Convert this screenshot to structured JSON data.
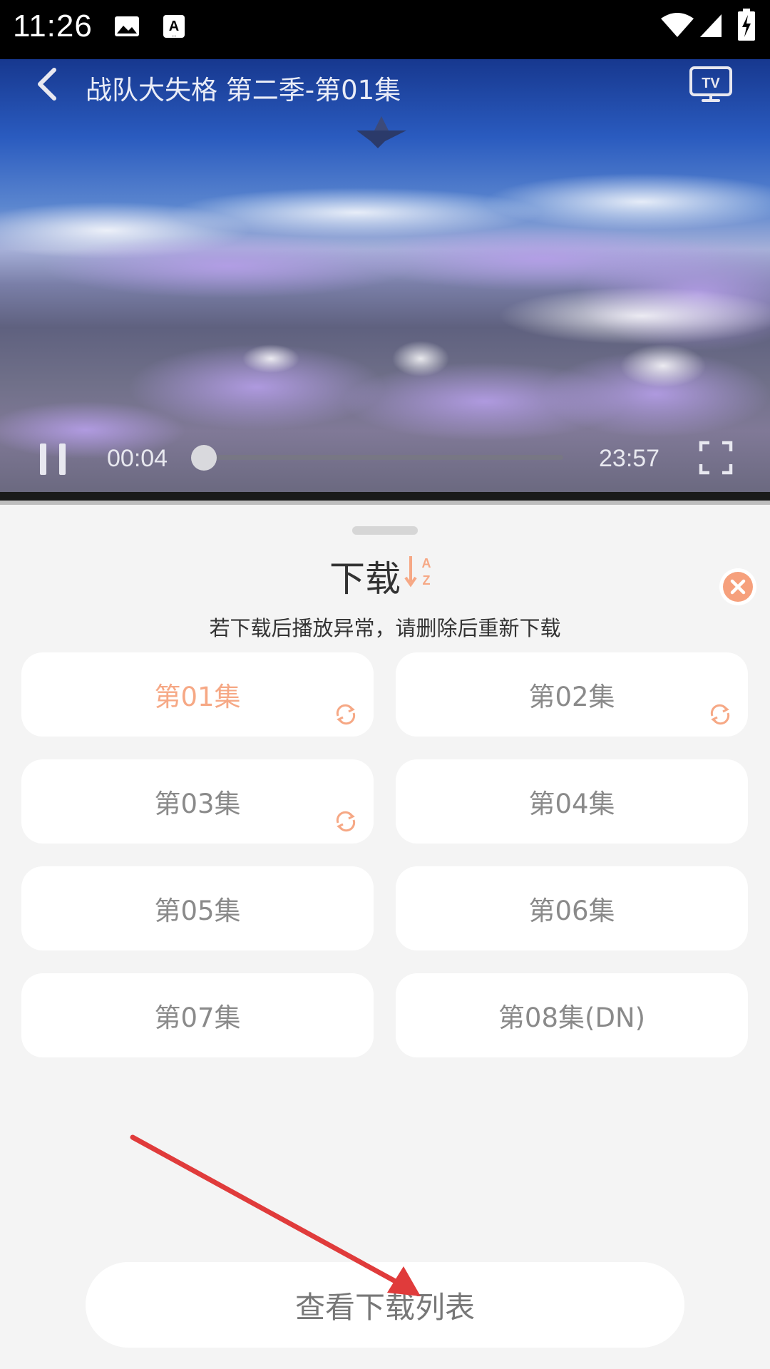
{
  "status_bar": {
    "time": "11:26",
    "icons": [
      "image-icon",
      "a-text-icon",
      "wifi-icon",
      "signal-icon",
      "battery-charging-icon"
    ]
  },
  "video": {
    "title": "战队大失格 第二季-第01集",
    "current_time": "00:04",
    "total_time": "23:57",
    "progress": 0.003,
    "icons": {
      "back": "chevron-left-icon",
      "cast": "tv-icon",
      "pause": "pause-icon",
      "fullscreen": "fullscreen-icon"
    }
  },
  "sheet": {
    "title": "下载",
    "sort_icon": "sort-az-icon",
    "close_icon": "close-icon",
    "notice": "若下载后播放异常，请删除后重新下载",
    "episodes": [
      {
        "label": "第01集",
        "active": true,
        "downloading": true
      },
      {
        "label": "第02集",
        "active": false,
        "downloading": true
      },
      {
        "label": "第03集",
        "active": false,
        "downloading": true
      },
      {
        "label": "第04集",
        "active": false,
        "downloading": false
      },
      {
        "label": "第05集",
        "active": false,
        "downloading": false
      },
      {
        "label": "第06集",
        "active": false,
        "downloading": false
      },
      {
        "label": "第07集",
        "active": false,
        "downloading": false
      },
      {
        "label": "第08集(DN)",
        "active": false,
        "downloading": false
      }
    ],
    "view_list_label": "查看下载列表"
  },
  "colors": {
    "accent": "#f6a885",
    "close_bg": "#f6a07c",
    "annotation_arrow": "#e03b3b"
  }
}
